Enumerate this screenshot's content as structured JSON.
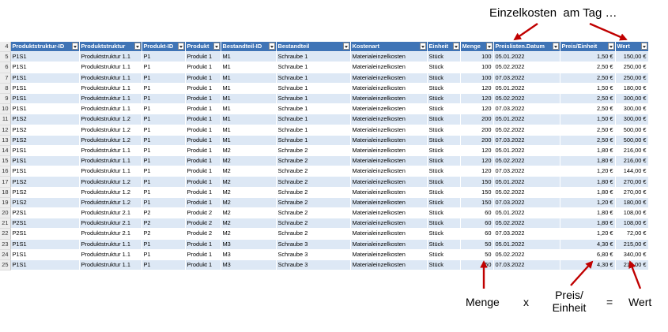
{
  "row_numbers": [
    "4",
    "5",
    "6",
    "7",
    "8",
    "9",
    "10",
    "11",
    "12",
    "13",
    "14",
    "15",
    "16",
    "17",
    "18",
    "19",
    "20",
    "21",
    "22",
    "23",
    "24",
    "25"
  ],
  "columns": [
    "Produktstruktur-ID",
    "Produktstruktur",
    "Produkt-ID",
    "Produkt",
    "Bestandteil-ID",
    "Bestandteil",
    "Kostenart",
    "Einheit",
    "Menge",
    "Preislisten.Datum",
    "Preis/Einheit",
    "Wert"
  ],
  "rows": [
    [
      "P1S1",
      "Produktstruktur 1.1",
      "P1",
      "Produkt 1",
      "M1",
      "Schraube 1",
      "Materialeinzelkosten",
      "Stück",
      "100",
      "05.01.2022",
      "1,50 €",
      "150,00 €"
    ],
    [
      "P1S1",
      "Produktstruktur 1.1",
      "P1",
      "Produkt 1",
      "M1",
      "Schraube 1",
      "Materialeinzelkosten",
      "Stück",
      "100",
      "05.02.2022",
      "2,50 €",
      "250,00 €"
    ],
    [
      "P1S1",
      "Produktstruktur 1.1",
      "P1",
      "Produkt 1",
      "M1",
      "Schraube 1",
      "Materialeinzelkosten",
      "Stück",
      "100",
      "07.03.2022",
      "2,50 €",
      "250,00 €"
    ],
    [
      "P1S1",
      "Produktstruktur 1.1",
      "P1",
      "Produkt 1",
      "M1",
      "Schraube 1",
      "Materialeinzelkosten",
      "Stück",
      "120",
      "05.01.2022",
      "1,50 €",
      "180,00 €"
    ],
    [
      "P1S1",
      "Produktstruktur 1.1",
      "P1",
      "Produkt 1",
      "M1",
      "Schraube 1",
      "Materialeinzelkosten",
      "Stück",
      "120",
      "05.02.2022",
      "2,50 €",
      "300,00 €"
    ],
    [
      "P1S1",
      "Produktstruktur 1.1",
      "P1",
      "Produkt 1",
      "M1",
      "Schraube 1",
      "Materialeinzelkosten",
      "Stück",
      "120",
      "07.03.2022",
      "2,50 €",
      "300,00 €"
    ],
    [
      "P1S2",
      "Produktstruktur 1.2",
      "P1",
      "Produkt 1",
      "M1",
      "Schraube 1",
      "Materialeinzelkosten",
      "Stück",
      "200",
      "05.01.2022",
      "1,50 €",
      "300,00 €"
    ],
    [
      "P1S2",
      "Produktstruktur 1.2",
      "P1",
      "Produkt 1",
      "M1",
      "Schraube 1",
      "Materialeinzelkosten",
      "Stück",
      "200",
      "05.02.2022",
      "2,50 €",
      "500,00 €"
    ],
    [
      "P1S2",
      "Produktstruktur 1.2",
      "P1",
      "Produkt 1",
      "M1",
      "Schraube 1",
      "Materialeinzelkosten",
      "Stück",
      "200",
      "07.03.2022",
      "2,50 €",
      "500,00 €"
    ],
    [
      "P1S1",
      "Produktstruktur 1.1",
      "P1",
      "Produkt 1",
      "M2",
      "Schraube 2",
      "Materialeinzelkosten",
      "Stück",
      "120",
      "05.01.2022",
      "1,80 €",
      "216,00 €"
    ],
    [
      "P1S1",
      "Produktstruktur 1.1",
      "P1",
      "Produkt 1",
      "M2",
      "Schraube 2",
      "Materialeinzelkosten",
      "Stück",
      "120",
      "05.02.2022",
      "1,80 €",
      "216,00 €"
    ],
    [
      "P1S1",
      "Produktstruktur 1.1",
      "P1",
      "Produkt 1",
      "M2",
      "Schraube 2",
      "Materialeinzelkosten",
      "Stück",
      "120",
      "07.03.2022",
      "1,20 €",
      "144,00 €"
    ],
    [
      "P1S2",
      "Produktstruktur 1.2",
      "P1",
      "Produkt 1",
      "M2",
      "Schraube 2",
      "Materialeinzelkosten",
      "Stück",
      "150",
      "05.01.2022",
      "1,80 €",
      "270,00 €"
    ],
    [
      "P1S2",
      "Produktstruktur 1.2",
      "P1",
      "Produkt 1",
      "M2",
      "Schraube 2",
      "Materialeinzelkosten",
      "Stück",
      "150",
      "05.02.2022",
      "1,80 €",
      "270,00 €"
    ],
    [
      "P1S2",
      "Produktstruktur 1.2",
      "P1",
      "Produkt 1",
      "M2",
      "Schraube 2",
      "Materialeinzelkosten",
      "Stück",
      "150",
      "07.03.2022",
      "1,20 €",
      "180,00 €"
    ],
    [
      "P2S1",
      "Produktstruktur 2.1",
      "P2",
      "Produkt 2",
      "M2",
      "Schraube 2",
      "Materialeinzelkosten",
      "Stück",
      "60",
      "05.01.2022",
      "1,80 €",
      "108,00 €"
    ],
    [
      "P2S1",
      "Produktstruktur 2.1",
      "P2",
      "Produkt 2",
      "M2",
      "Schraube 2",
      "Materialeinzelkosten",
      "Stück",
      "60",
      "05.02.2022",
      "1,80 €",
      "108,00 €"
    ],
    [
      "P2S1",
      "Produktstruktur 2.1",
      "P2",
      "Produkt 2",
      "M2",
      "Schraube 2",
      "Materialeinzelkosten",
      "Stück",
      "60",
      "07.03.2022",
      "1,20 €",
      "72,00 €"
    ],
    [
      "P1S1",
      "Produktstruktur 1.1",
      "P1",
      "Produkt 1",
      "M3",
      "Schraube 3",
      "Materialeinzelkosten",
      "Stück",
      "50",
      "05.01.2022",
      "4,30 €",
      "215,00 €"
    ],
    [
      "P1S1",
      "Produktstruktur 1.1",
      "P1",
      "Produkt 1",
      "M3",
      "Schraube 3",
      "Materialeinzelkosten",
      "Stück",
      "50",
      "05.02.2022",
      "6,80 €",
      "340,00 €"
    ],
    [
      "P1S1",
      "Produktstruktur 1.1",
      "P1",
      "Produkt 1",
      "M3",
      "Schraube 3",
      "Materialeinzelkosten",
      "Stück",
      "50",
      "07.03.2022",
      "4,30 €",
      "215,00 €"
    ]
  ],
  "annotations": {
    "top": "Einzelkosten  am Tag …",
    "menge": "Menge",
    "times": "x",
    "preis_line1": "Preis/",
    "preis_line2": "Einheit",
    "equals": "=",
    "wert": "Wert"
  },
  "colors": {
    "header_bg": "#3f74b6",
    "band_bg": "#dde8f5",
    "arrow": "#c00000"
  }
}
